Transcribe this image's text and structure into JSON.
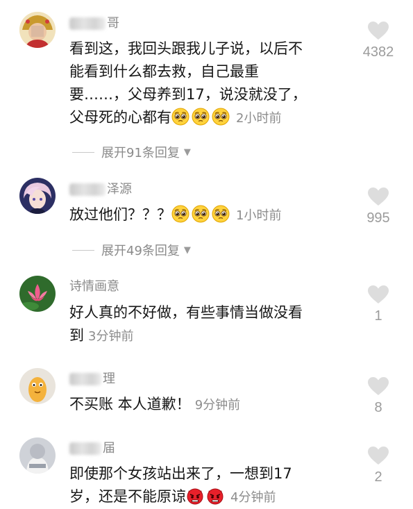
{
  "colors": {
    "text": "#161616",
    "muted": "#8c8c8c",
    "heart": "#dddddd"
  },
  "comments": [
    {
      "username_visible": "哥",
      "text_lines": [
        "看到这，我回头跟我儿子说，以后不",
        "能看到什么都去救，自己最重",
        "要……，父母养到17，说没就没了，",
        "父母死的心都有"
      ],
      "emojis": [
        "pleading-face-emoji",
        "pleading-face-emoji",
        "pleading-face-emoji"
      ],
      "time": "2小时前",
      "likes": "4382",
      "replies": "展开91条回复"
    },
    {
      "username_visible": "泽源",
      "text_lines": [
        "放过他们？？？"
      ],
      "emojis": [
        "pleading-face-emoji",
        "pleading-face-emoji",
        "pleading-face-emoji"
      ],
      "time": "1小时前",
      "likes": "995",
      "replies": "展开49条回复"
    },
    {
      "username_visible": "诗情画意",
      "text_lines": [
        "好人真的不好做，有些事情当做没看",
        "到"
      ],
      "time": "3分钟前",
      "likes": "1"
    },
    {
      "username_visible": "理",
      "text_lines": [
        "不买账 本人道歉！"
      ],
      "time": "9分钟前",
      "likes": "8"
    },
    {
      "username_visible": "届",
      "text_lines": [
        "即使那个女孩站出来了，一想到17",
        "岁，还是不能原谅"
      ],
      "emojis": [
        "angry-devil-emoji",
        "angry-devil-emoji"
      ],
      "time": "4分钟前",
      "likes": "2"
    }
  ]
}
